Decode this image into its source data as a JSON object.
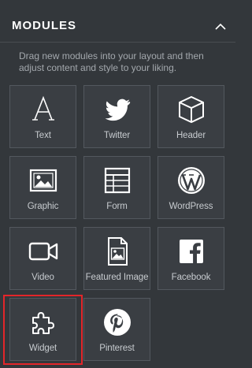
{
  "panel": {
    "title": "MODULES",
    "description": "Drag new modules into your layout and then adjust content and style to your liking."
  },
  "icons": {
    "collapse": "chevron-up-icon"
  },
  "modules": [
    {
      "label": "Text",
      "icon": "text-a-icon"
    },
    {
      "label": "Twitter",
      "icon": "twitter-bird-icon"
    },
    {
      "label": "Header",
      "icon": "cube-icon"
    },
    {
      "label": "Graphic",
      "icon": "image-icon"
    },
    {
      "label": "Form",
      "icon": "table-icon"
    },
    {
      "label": "WordPress",
      "icon": "wordpress-icon"
    },
    {
      "label": "Video",
      "icon": "video-camera-icon"
    },
    {
      "label": "Featured Image",
      "icon": "featured-image-icon"
    },
    {
      "label": "Facebook",
      "icon": "facebook-icon"
    },
    {
      "label": "Widget",
      "icon": "puzzle-piece-icon"
    },
    {
      "label": "Pinterest",
      "icon": "pinterest-icon"
    }
  ],
  "colors": {
    "background": "#33373b",
    "tile_background": "#3a3e43",
    "tile_border": "#53585e",
    "icon": "#ffffff",
    "highlight": "#e3262a"
  }
}
